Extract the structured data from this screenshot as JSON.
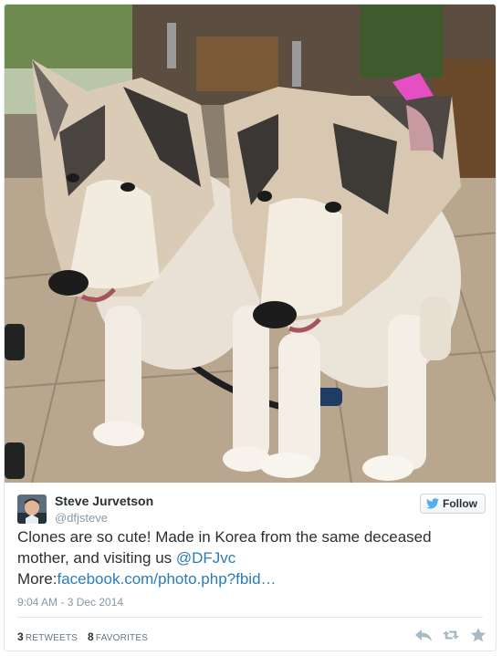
{
  "tweet": {
    "author_name": "Steve Jurvetson",
    "author_handle": "@dfjsteve",
    "follow_label": "Follow",
    "text_main": "Clones are so cute! Made in Korea from the same deceased mother, and visiting us ",
    "mention": "@DFJvc",
    "more_prefix": "More:",
    "link_text": "facebook.com/photo.php?fbid…",
    "timestamp": "9:04 AM - 3 Dec 2014",
    "retweets_count": "3",
    "retweets_label": "RETWEETS",
    "favorites_count": "8",
    "favorites_label": "FAVORITES"
  },
  "colors": {
    "link": "#2b7bb9",
    "muted": "#8899a6",
    "text": "#292f33",
    "bird": "#55acee",
    "action_icon": "#aab8c2"
  },
  "icons": {
    "follow": "twitter-bird-icon",
    "reply": "reply-icon",
    "retweet": "retweet-icon",
    "favorite": "star-icon"
  }
}
